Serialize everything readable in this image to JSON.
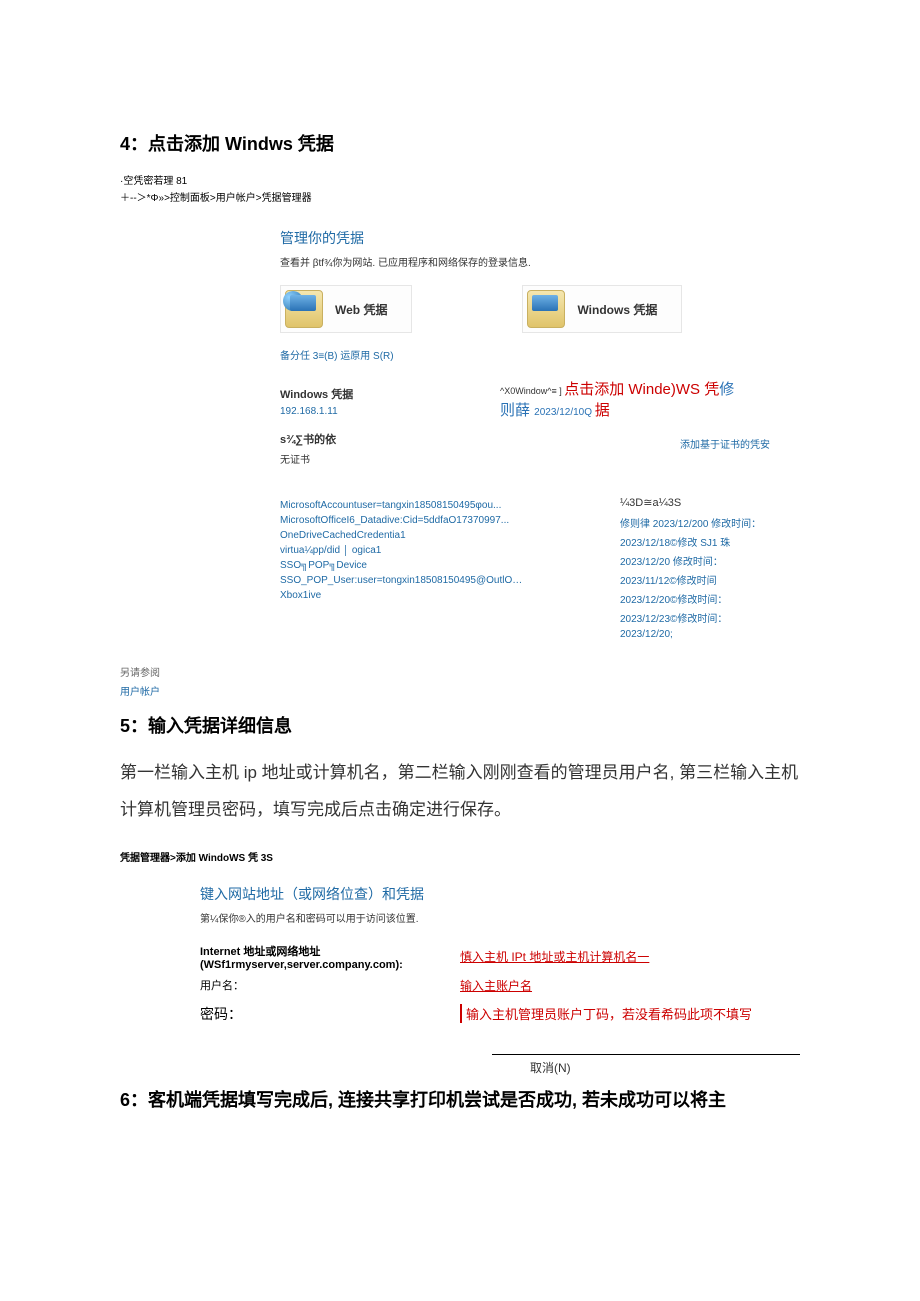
{
  "step4": {
    "title": "4：点击添加 Windws 凭据",
    "note": "·空凭密若理 81",
    "breadcrumb": "＋--＞*Φ»>控制面板>用户帐户>凭据管理器",
    "manage_title": "管理你的凭据",
    "manage_sub": "查看并 βtf¾你为网站. 已应用程序和网络保存的登录信息.",
    "web_cred": "Web 凭据",
    "windows_cred": "Windows 凭据",
    "backup_restore": "备分任 3≡(B)   运原用 S(R)",
    "win_cred_header": "Windows 凭据",
    "ip": "192.168.1.11",
    "cert_note": "s¾∑书的依",
    "no_cert": "无证书",
    "annot_pre": "^X0Window^≡ ] ",
    "annot_main": "点击添加 Winde)WS 凭",
    "annot_fix": "修",
    "annot_line2a": "则薛 ",
    "annot_date": "2023/12/10Q ",
    "annot_line2b": "据",
    "add_cert": "添加基于证书的凭安",
    "items": [
      "MicrosoftAccountuser=tangxin18508150495φou...",
      "MicrosoftOfficeI6_Datadive:Cid=5ddfaO17370997...",
      "OneDriveCachedCredentia1",
      "virtua¼pp/did │ ogica1",
      "SSO╗POP╗Device",
      "SSO_POP_User:user=tongxin18508150495@OutlO…",
      "Xbox1ive"
    ],
    "dates_header": "¼3D≅a¼3S",
    "dates": [
      "修则律 2023/12/200 修改时间：",
      "2023/12/18©修改 SJ1 珠",
      "2023/12/20 修改时间：",
      "2023/11/12©修改时间",
      "2023/12/20©修改时间：",
      "2023/12/23©修改时间：",
      "2023/12/20;"
    ],
    "refs_title": "另请参阅",
    "refs_link": "用户帐户"
  },
  "step5": {
    "title": "5：输入凭据详细信息",
    "body": "第一栏输入主机 ip 地址或计算机名，第二栏输入刚刚查看的管理员用户名, 第三栏输入主机计算机管理员密码，填写完成后点击确定进行保存。",
    "breadcrumb": "凭据管理器>添加 WindoWS 凭 3S",
    "form_title": "键入网站地址（或网络位查）和凭据",
    "form_sub": "第¼保你®入的用户名和密码可以用于访问该位置.",
    "addr_label": "Internet 地址或网络地址\n(WSf1rmyserver,server.company.com):",
    "addr_value": "慎入主机 IPt 地址或主机计算机名一",
    "user_label": "用户名：",
    "user_value": "输入主账户名",
    "pw_label": "密码：",
    "pw_value": "输入主机管理员账户丁码，若没看希码此项不填写",
    "cancel": "取消(N)"
  },
  "step6": {
    "title": "6：客机端凭据填写完成后, 连接共享打印机尝试是否成功, 若未成功可以将主"
  }
}
